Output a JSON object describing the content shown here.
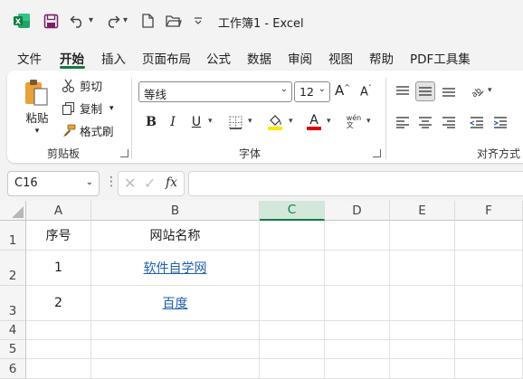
{
  "app": {
    "title": "工作簿1  -  Excel",
    "brand_color": "#107c41"
  },
  "menu_tabs": [
    "文件",
    "开始",
    "插入",
    "页面布局",
    "公式",
    "数据",
    "审阅",
    "视图",
    "帮助",
    "PDF工具集"
  ],
  "active_tab": "开始",
  "clipboard": {
    "paste": "粘贴",
    "cut": "剪切",
    "copy": "复制",
    "format_painter": "格式刷",
    "label": "剪贴板"
  },
  "font": {
    "name": "等线",
    "size": "12",
    "label": "字体",
    "font_color": "#c00000",
    "highlight_color": "#ffe600"
  },
  "alignment": {
    "label": "对齐方式"
  },
  "formula_bar": {
    "name_box": "C16",
    "fx": "fx",
    "formula": ""
  },
  "columns": [
    "A",
    "B",
    "C",
    "D",
    "E",
    "F"
  ],
  "selected_column": "C",
  "rows": [
    "1",
    "2",
    "3",
    "4",
    "5",
    "6"
  ],
  "cells": {
    "A1": "序号",
    "B1": "网站名称",
    "A2": "1",
    "B2": "软件自学网",
    "A3": "2",
    "B3": "百度"
  }
}
